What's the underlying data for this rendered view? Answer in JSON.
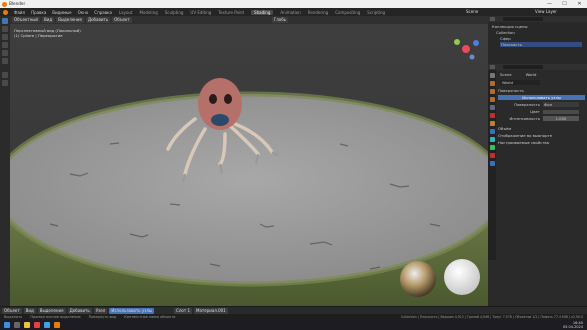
{
  "window": {
    "title": "Blender",
    "minimize": "—",
    "maximize": "☐",
    "close": "✕"
  },
  "menu": {
    "items": [
      "Файл",
      "Правка",
      "Видимые",
      "Окно",
      "Справка"
    ],
    "workspaces": [
      "Layout",
      "Modeling",
      "Sculpting",
      "UV Editing",
      "Texture Paint",
      "Shading",
      "Animation",
      "Rendering",
      "Compositing",
      "Scripting"
    ],
    "active_workspace": "Shading",
    "scene": "Scene",
    "view_layer": "View Layer"
  },
  "header3d": {
    "mode": "Объектный",
    "menus": [
      "Вид",
      "Выделение",
      "Добавить",
      "Объект"
    ],
    "transform": "Глобь"
  },
  "viewport": {
    "info_line1": "Перспективный вид (Локальный)",
    "info_line2": "(1) Сphere | Перекрытие"
  },
  "outliner": {
    "title": "Коллекция сцены",
    "items": [
      "Collection",
      "Сфер",
      "Плоскость"
    ]
  },
  "properties": {
    "tabs": [
      "Scene",
      "World"
    ],
    "breadcrumb": "World",
    "sections": {
      "surface": "Поверхность",
      "surface_button": "Использовать узлы",
      "rows": [
        {
          "label": "Поверхность",
          "value": "Фон"
        },
        {
          "label": "Цвет",
          "value": ""
        },
        {
          "label": "Интенсивность",
          "value": "1.000"
        }
      ],
      "collapsed": [
        "Объём",
        "Отображение во вьюпорте",
        "Настраиваемые свойства"
      ]
    }
  },
  "bottom_header": {
    "mode": "Объект",
    "menus": [
      "Вид",
      "Выделение",
      "Добавить",
      "Узел"
    ],
    "use_nodes": "Использовать узлы",
    "slot": "Слот 1",
    "material": "Материал.001"
  },
  "statusbar": {
    "left": "Выделить",
    "middle": "Прямоугольное выделение",
    "right": "Повернуть вид",
    "menu": "Контекстное меню объекта",
    "stats": "Collection | Плоскость | Вершин 4,912 | Граней 4,946 | Треуг 7,578 | Объектов 1/2 | Память 77.4 MiB | v2.90.0"
  },
  "taskbar": {
    "time": "16:40",
    "date": "05.04.2024"
  },
  "colors": {
    "accent": "#4772b3",
    "active_tab": "#4a4a4a"
  }
}
